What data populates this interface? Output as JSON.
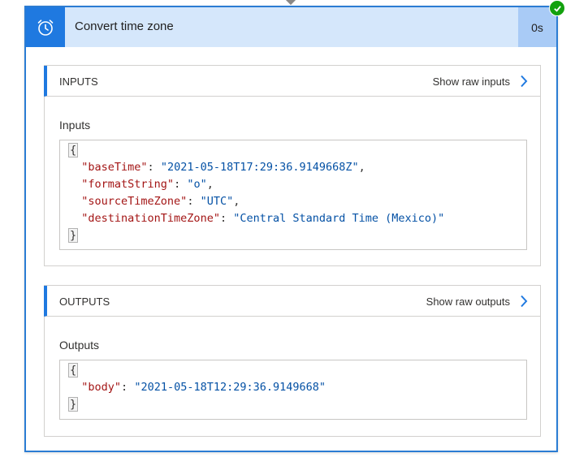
{
  "action": {
    "title": "Convert time zone",
    "duration": "0s",
    "icon": "alarm-clock-icon",
    "status": "succeeded"
  },
  "inputs_section": {
    "heading": "INPUTS",
    "raw_link": "Show raw inputs",
    "label": "Inputs",
    "open_brace": "{",
    "close_brace": "}",
    "params": [
      {
        "key": "\"baseTime\"",
        "value": "\"2021-05-18T17:29:36.9149668Z\"",
        "sep": ","
      },
      {
        "key": "\"formatString\"",
        "value": "\"o\"",
        "sep": ","
      },
      {
        "key": "\"sourceTimeZone\"",
        "value": "\"UTC\"",
        "sep": ","
      },
      {
        "key": "\"destinationTimeZone\"",
        "value": "\"Central Standard Time (Mexico)\"",
        "sep": ""
      }
    ]
  },
  "outputs_section": {
    "heading": "OUTPUTS",
    "raw_link": "Show raw outputs",
    "label": "Outputs",
    "open_brace": "{",
    "close_brace": "}",
    "params": [
      {
        "key": "\"body\"",
        "value": "\"2021-05-18T12:29:36.9149668\"",
        "sep": ""
      }
    ]
  },
  "colors": {
    "accent": "#1f79e0",
    "header_bg": "#d5e7fb",
    "success": "#13a10e",
    "json_key": "#a31515",
    "json_value": "#0451a5"
  }
}
